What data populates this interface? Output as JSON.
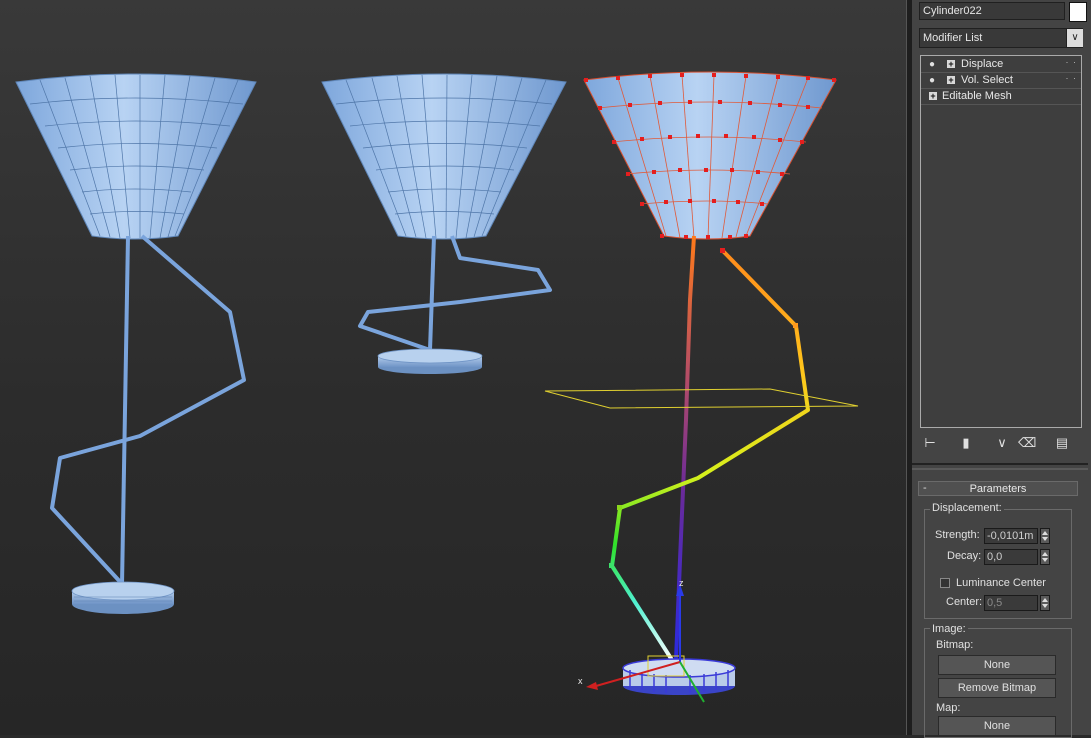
{
  "object_name": "Cylinder022",
  "modifier_list": {
    "label": "Modifier List",
    "arrow": "chevron-down-icon"
  },
  "modifier_stack": [
    {
      "label": "Displace",
      "icon": "lightbulb-icon"
    },
    {
      "label": "Vol. Select",
      "icon": "lightbulb-icon"
    },
    {
      "label": "Editable Mesh",
      "icon": null
    }
  ],
  "stack_toolbar": [
    "pin-stack-icon",
    "show-end-result-icon",
    "make-unique-icon",
    "remove-modifier-icon",
    "configure-modifier-sets-icon"
  ],
  "parameters": {
    "rollout_title": "Parameters",
    "rollout_toggle": "-",
    "displacement": {
      "group_label": "Displacement:",
      "strength_label": "Strength:",
      "strength_value": "-0,0101m",
      "decay_label": "Decay:",
      "decay_value": "0,0",
      "luminance_center_label": "Luminance Center",
      "luminance_center_checked": false,
      "center_label": "Center:",
      "center_value": "0,5"
    },
    "image": {
      "group_label": "Image:",
      "bitmap_label": "Bitmap:",
      "bitmap_button": "None",
      "remove_bitmap_button": "Remove Bitmap",
      "map_label": "Map:",
      "map_button": "None"
    }
  },
  "viewport": {
    "gizmo_axis_labels": [
      "z",
      "x"
    ],
    "mesh_color": "#8cb8ec",
    "selected_vertex_color": "#e51e1e"
  }
}
